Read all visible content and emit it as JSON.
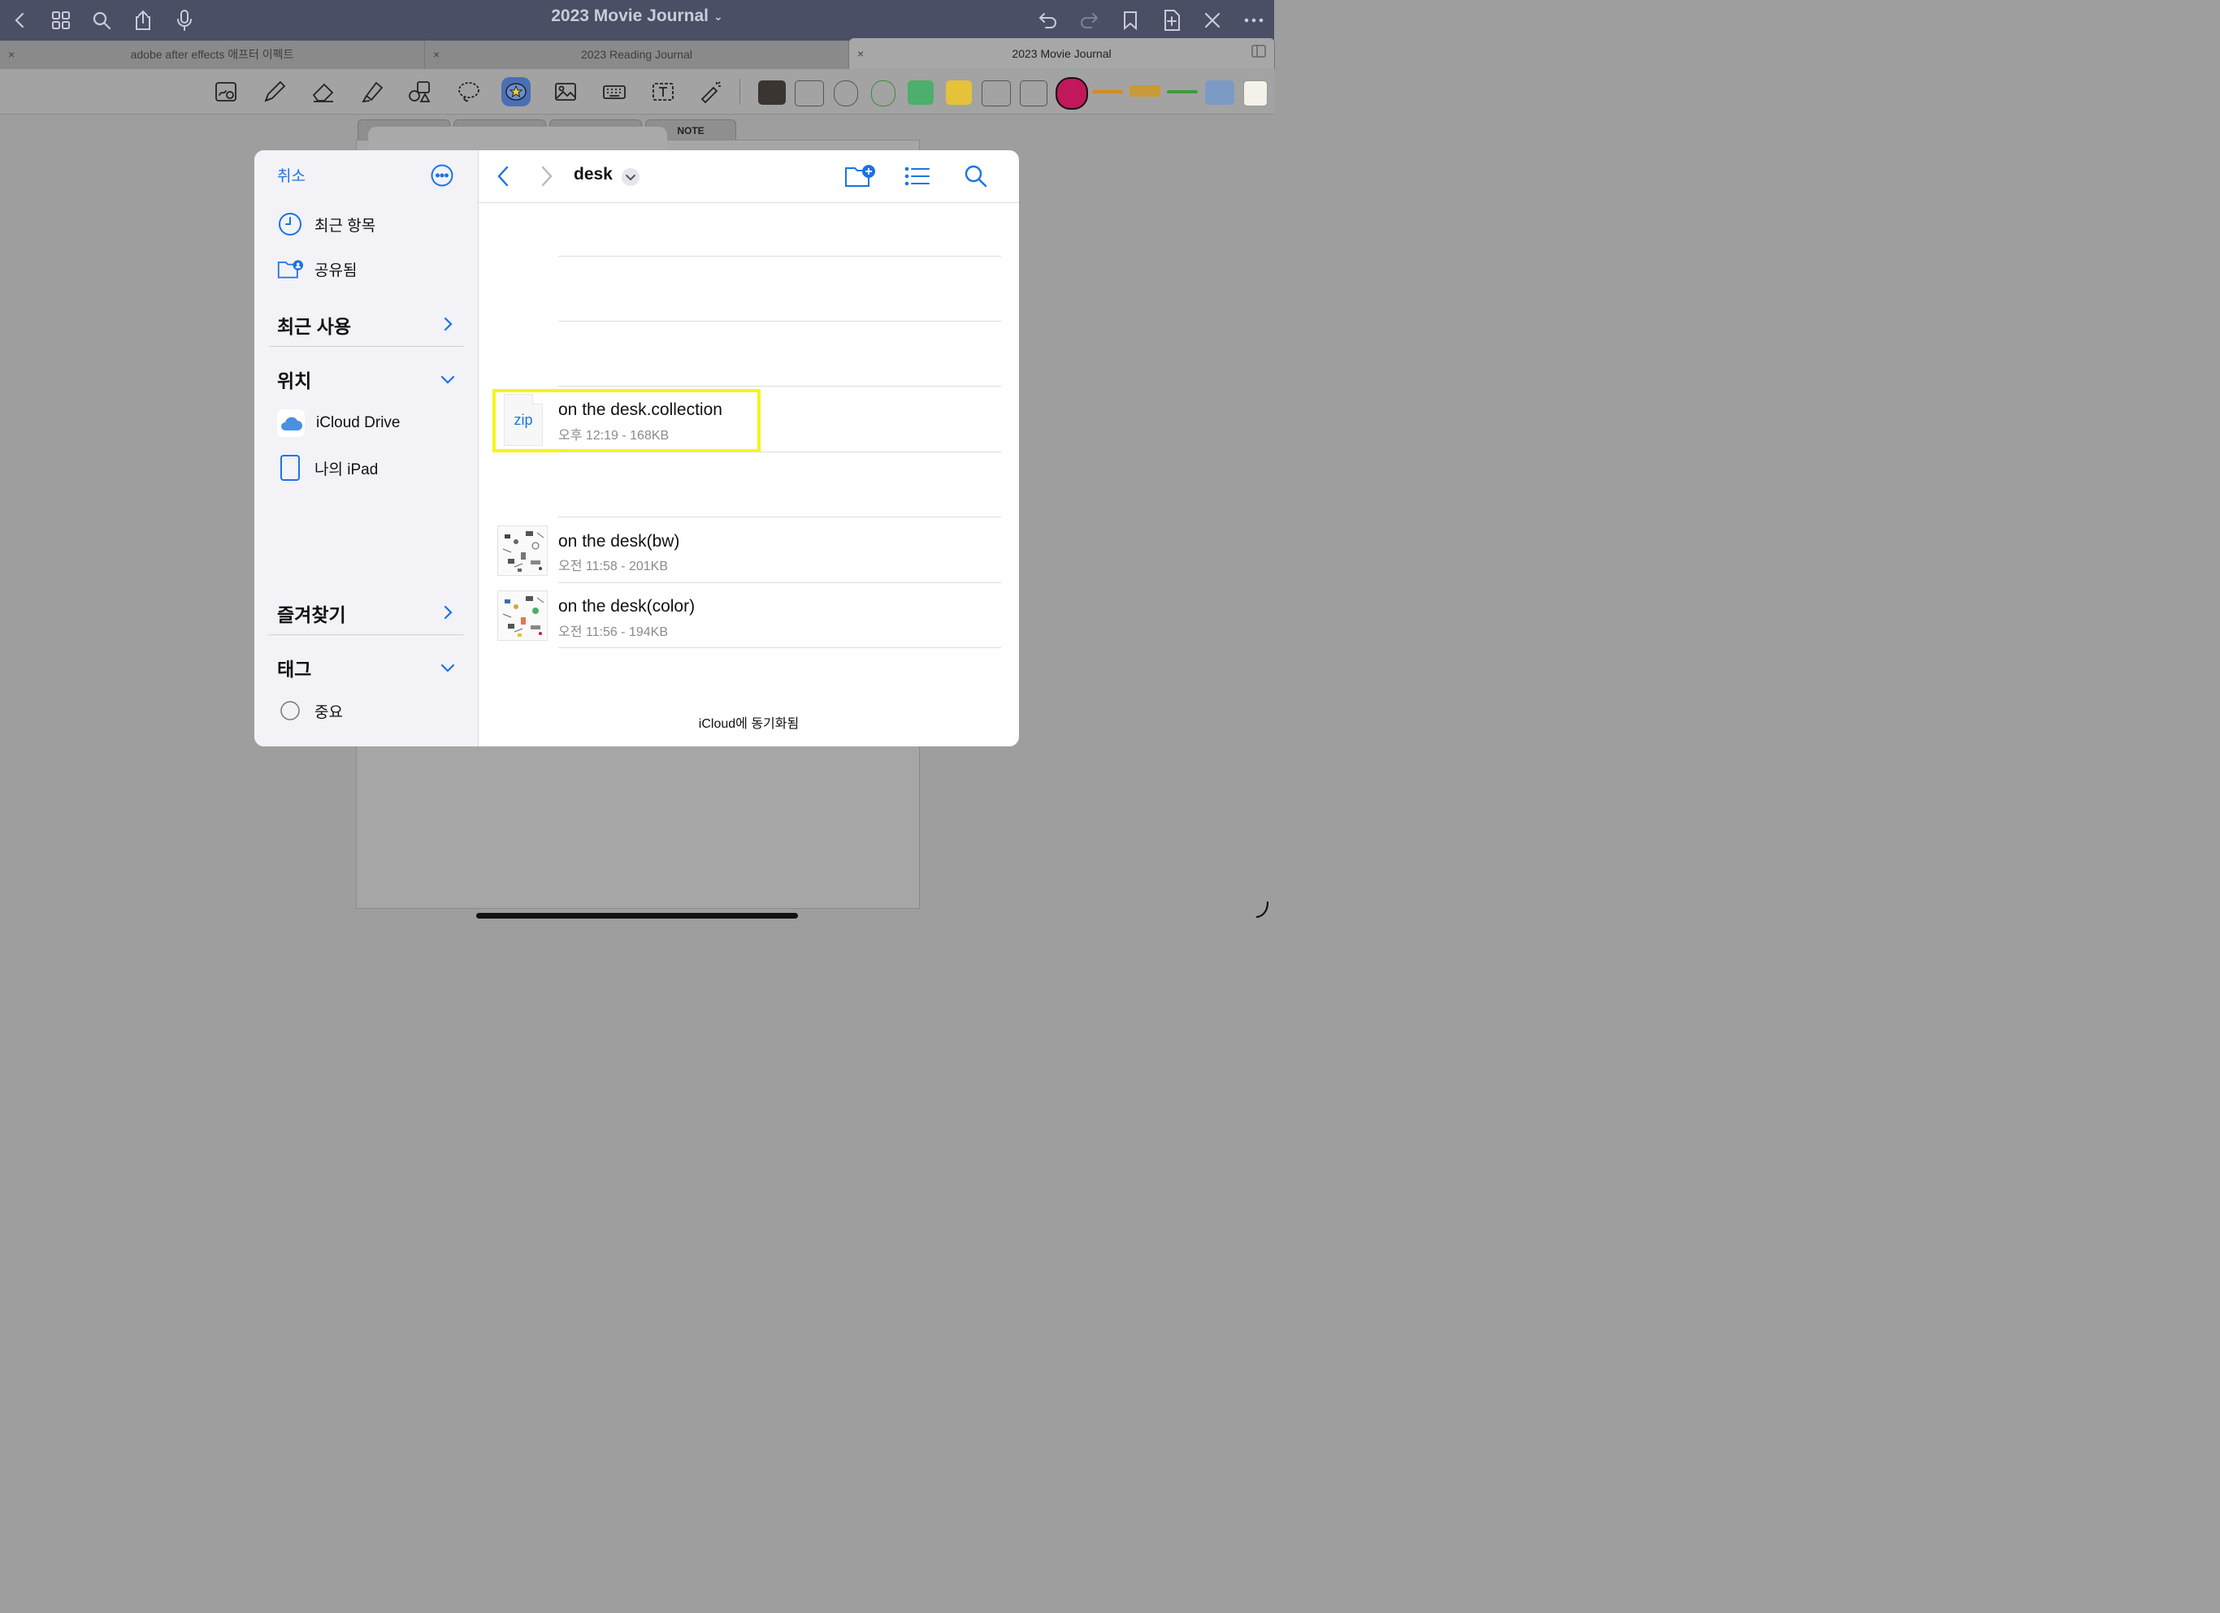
{
  "app": {
    "title": "2023 Movie Journal",
    "title_chevron": "⌄"
  },
  "tabs": [
    {
      "label": "adobe after effects 애프터 이펙트",
      "active": false
    },
    {
      "label": "2023 Reading Journal",
      "active": false
    },
    {
      "label": "2023 Movie Journal",
      "active": true
    }
  ],
  "tab_close": "×",
  "page": {
    "tab_note": "NOTE"
  },
  "dialog": {
    "cancel": "취소",
    "sidebar": {
      "recents_item": "최근 항목",
      "shared_item": "공유됨",
      "recent_used_header": "최근 사용",
      "locations_header": "위치",
      "icloud_drive": "iCloud Drive",
      "my_ipad": "나의 iPad",
      "favorites_header": "즐겨찾기",
      "tags_header": "태그",
      "tag_important": "중요"
    },
    "folder_title": "desk",
    "files": [
      {
        "name": "on the desk.collection",
        "meta": "오후 12:19 - 168KB",
        "icon": "zip"
      },
      {
        "name": "on the desk(bw)",
        "meta": "오전 11:58 - 201KB",
        "icon": "pattern-bw"
      },
      {
        "name": "on the desk(color)",
        "meta": "오전 11:56 - 194KB",
        "icon": "pattern-color"
      }
    ],
    "sync_status": "iCloud에 동기화됨"
  },
  "colors": {
    "accent": "#1a73e8",
    "highlight": "#f5f51a",
    "topbar": "#4a4f66"
  }
}
